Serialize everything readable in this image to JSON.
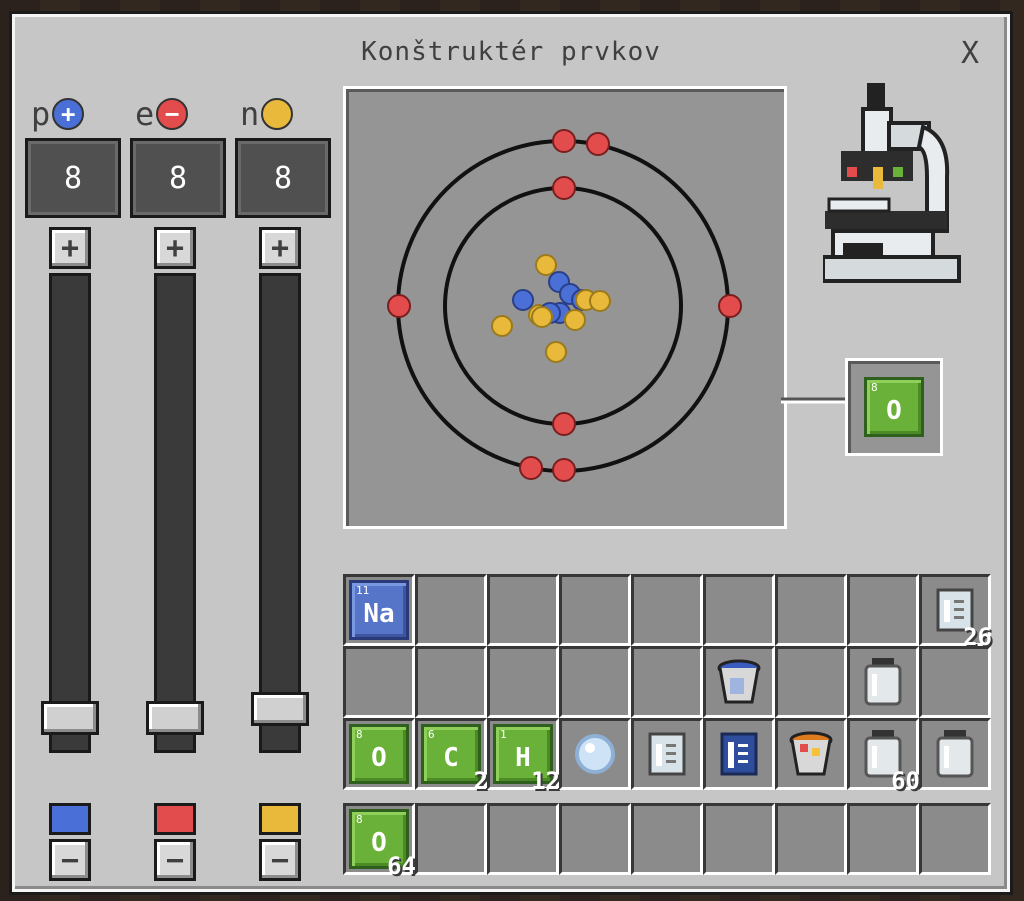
{
  "window": {
    "title": "Konštruktér prvkov",
    "close_label": "X"
  },
  "particles": [
    {
      "letter": "p",
      "sign": "+",
      "color": "#4a6fd6",
      "count": "8",
      "plus": "+",
      "minus": "−",
      "level": 0.96
    },
    {
      "letter": "e",
      "sign": "−",
      "color": "#e24c4c",
      "count": "8",
      "plus": "+",
      "minus": "−",
      "level": 0.96
    },
    {
      "letter": "n",
      "sign": "",
      "color": "#e8b93a",
      "count": "8",
      "plus": "+",
      "minus": "−",
      "level": 0.94
    }
  ],
  "output_element": {
    "atomic_number": "8",
    "symbol": "O"
  },
  "inventory": {
    "rows": [
      [
        {
          "kind": "element",
          "color": "blue",
          "number": "11",
          "symbol": "Na",
          "count": ""
        },
        {
          "kind": "empty"
        },
        {
          "kind": "empty"
        },
        {
          "kind": "empty"
        },
        {
          "kind": "empty"
        },
        {
          "kind": "empty"
        },
        {
          "kind": "empty"
        },
        {
          "kind": "empty"
        },
        {
          "kind": "beaker-empty",
          "count": "26"
        }
      ],
      [
        {
          "kind": "empty"
        },
        {
          "kind": "empty"
        },
        {
          "kind": "empty"
        },
        {
          "kind": "empty"
        },
        {
          "kind": "empty"
        },
        {
          "kind": "bucket-blue"
        },
        {
          "kind": "empty"
        },
        {
          "kind": "jar"
        },
        {
          "kind": "empty"
        }
      ],
      [
        {
          "kind": "element",
          "color": "green",
          "number": "8",
          "symbol": "O",
          "count": ""
        },
        {
          "kind": "element",
          "color": "green",
          "number": "6",
          "symbol": "C",
          "count": "2"
        },
        {
          "kind": "element",
          "color": "green",
          "number": "1",
          "symbol": "H",
          "count": "12"
        },
        {
          "kind": "ice-ball"
        },
        {
          "kind": "beaker-light"
        },
        {
          "kind": "beaker-blue"
        },
        {
          "kind": "bucket-lava"
        },
        {
          "kind": "jar",
          "count": "60"
        },
        {
          "kind": "jar"
        }
      ]
    ],
    "hotbar": [
      {
        "kind": "element",
        "color": "green",
        "number": "8",
        "symbol": "O",
        "count": "64"
      },
      {
        "kind": "empty"
      },
      {
        "kind": "empty"
      },
      {
        "kind": "empty"
      },
      {
        "kind": "empty"
      },
      {
        "kind": "empty"
      },
      {
        "kind": "empty"
      },
      {
        "kind": "empty"
      },
      {
        "kind": "empty"
      }
    ]
  },
  "icons": {
    "microscope": "microscope-icon",
    "close": "close-icon"
  }
}
